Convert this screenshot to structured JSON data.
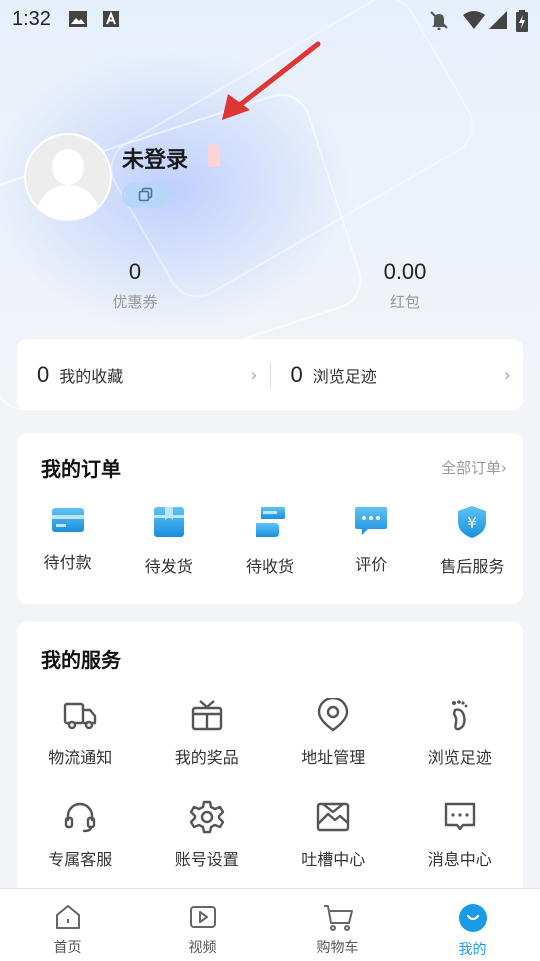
{
  "status_bar": {
    "time": "1:32"
  },
  "profile": {
    "username": "未登录"
  },
  "stats": [
    {
      "value": "0",
      "label": "优惠券"
    },
    {
      "value": "0.00",
      "label": "红包"
    }
  ],
  "quick_row": [
    {
      "count": "0",
      "label": "我的收藏"
    },
    {
      "count": "0",
      "label": "浏览足迹"
    }
  ],
  "orders": {
    "title": "我的订单",
    "all_label": "全部订单",
    "items": [
      {
        "label": "待付款",
        "icon": "card-icon"
      },
      {
        "label": "待发货",
        "icon": "box-icon"
      },
      {
        "label": "待收货",
        "icon": "receive-icon"
      },
      {
        "label": "评价",
        "icon": "comment-icon"
      },
      {
        "label": "售后服务",
        "icon": "shield-yen-icon"
      }
    ]
  },
  "services": {
    "title": "我的服务",
    "items": [
      {
        "label": "物流通知",
        "icon": "truck-icon"
      },
      {
        "label": "我的奖品",
        "icon": "gift-icon"
      },
      {
        "label": "地址管理",
        "icon": "location-icon"
      },
      {
        "label": "浏览足迹",
        "icon": "footprint-icon"
      },
      {
        "label": "专属客服",
        "icon": "headset-icon"
      },
      {
        "label": "账号设置",
        "icon": "gear-icon"
      },
      {
        "label": "吐槽中心",
        "icon": "image-icon"
      },
      {
        "label": "消息中心",
        "icon": "message-icon"
      }
    ]
  },
  "tabbar": {
    "items": [
      {
        "label": "首页",
        "icon": "home-icon"
      },
      {
        "label": "视频",
        "icon": "video-icon"
      },
      {
        "label": "购物车",
        "icon": "cart-icon"
      },
      {
        "label": "我的",
        "icon": "profile-icon"
      }
    ],
    "active": "我的"
  },
  "colors": {
    "accent": "#1a9be8",
    "icon_gray": "#555555"
  }
}
